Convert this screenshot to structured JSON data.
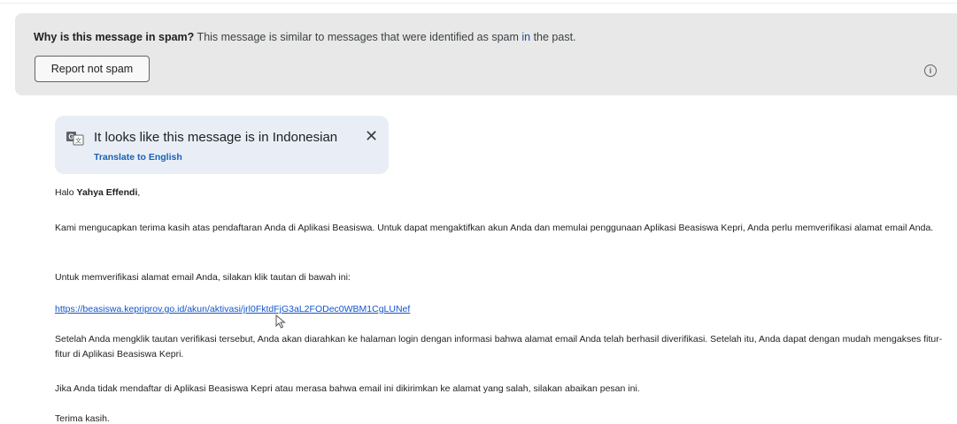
{
  "spam_banner": {
    "question": "Why is this message in spam?",
    "explanation_before": " This message is similar to messages that were identified as spam ",
    "explanation_kw": "in",
    "explanation_after": " the past.",
    "report_button": "Report not spam",
    "info_icon": "info-icon"
  },
  "translate": {
    "icon": "translate-icon",
    "message": "It looks like this message is in Indonesian",
    "close_icon": "close-icon",
    "link": "Translate to English"
  },
  "email": {
    "greeting_prefix": "Halo ",
    "recipient_name": "Yahya Effendi",
    "greeting_suffix": ",",
    "paragraph1": "Kami mengucapkan terima kasih atas pendaftaran Anda di Aplikasi Beasiswa. Untuk dapat mengaktifkan akun Anda dan memulai penggunaan Aplikasi Beasiswa Kepri, Anda perlu memverifikasi alamat email Anda.",
    "paragraph2": "Untuk memverifikasi alamat email Anda, silakan klik tautan di bawah ini:",
    "verification_link": "https://beasiswa.kepriprov.go.id/akun/aktivasi/jrl0FktdFjG3aL2FODec0WBM1CgLUNef",
    "paragraph3": "Setelah Anda mengklik tautan verifikasi tersebut, Anda akan diarahkan ke halaman login dengan informasi bahwa alamat email Anda telah berhasil diverifikasi. Setelah itu, Anda dapat dengan mudah mengakses fitur-fitur di Aplikasi Beasiswa Kepri.",
    "paragraph4": "Jika Anda tidak mendaftar di Aplikasi Beasiswa Kepri atau merasa bahwa email ini dikirimkan ke alamat yang salah, silakan abaikan pesan ini.",
    "closing": "Terima kasih."
  },
  "colors": {
    "banner_bg": "#e8e8e8",
    "translate_bg": "#e9eef6",
    "link": "#1155cc",
    "translate_link": "#1a5fb4"
  }
}
